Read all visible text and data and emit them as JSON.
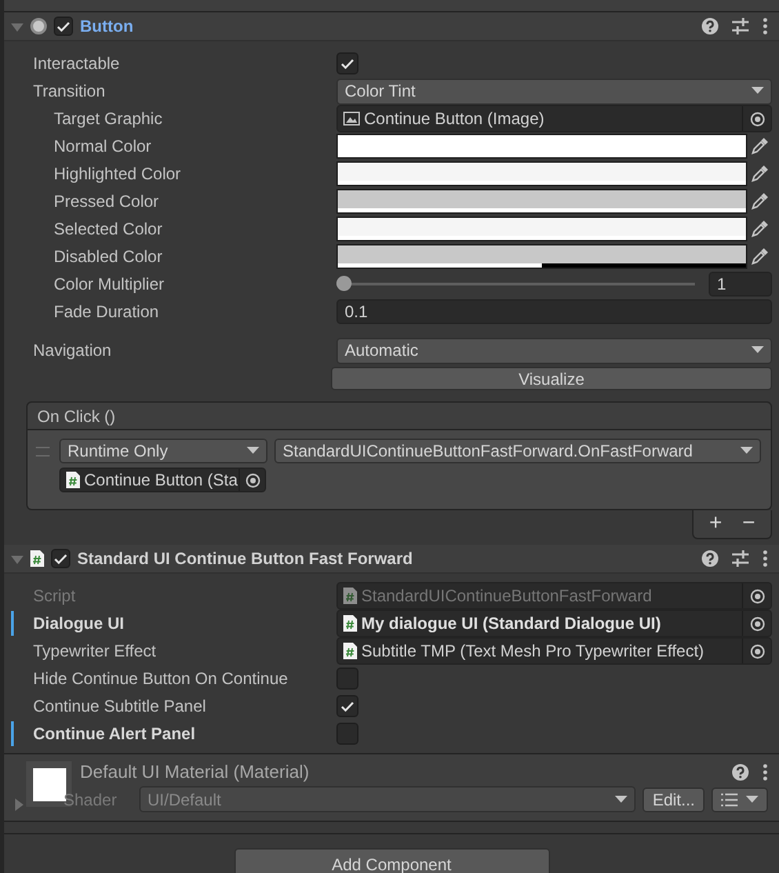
{
  "button_component": {
    "title": "Button",
    "highlighted": true,
    "enabled": true,
    "properties": [
      {
        "kind": "checkbox",
        "label": "Interactable",
        "checked": true
      },
      {
        "kind": "dropdown",
        "label": "Transition",
        "value": "Color Tint",
        "children": [
          {
            "kind": "image_object",
            "label": "Target Graphic",
            "value": "Continue Button (Image)"
          },
          {
            "kind": "color",
            "label": "Normal Color",
            "color": "#ffffff",
            "level": 1
          },
          {
            "kind": "color",
            "label": "Highlighted Color",
            "color": "#f5f5f5",
            "level": 1
          },
          {
            "kind": "color",
            "label": "Pressed Color",
            "color": "#c8c8c8",
            "level": 1
          },
          {
            "kind": "color",
            "label": "Selected Color",
            "color": "#f5f5f5",
            "level": 1
          },
          {
            "kind": "color",
            "label": "Disabled Color",
            "color": "#c8c8c8",
            "level": 0.5
          },
          {
            "kind": "slider",
            "label": "Color Multiplier",
            "level": 0,
            "value": "1"
          },
          {
            "kind": "number",
            "label": "Fade Duration",
            "value": "0.1"
          }
        ]
      }
    ],
    "navigation": {
      "label": "Navigation",
      "value": "Automatic"
    },
    "visualize_button": "Visualize",
    "event": {
      "title": "On Click ()",
      "listeners": [
        {
          "mode": "Runtime Only",
          "function": "StandardUIContinueButtonFastForward.OnFastForward",
          "target": "Continue Button (Sta"
        }
      ],
      "add": "+",
      "remove": "−"
    }
  },
  "script_component": {
    "title": "Standard UI Continue Button Fast Forward",
    "highlighted": false,
    "enabled": true,
    "properties": [
      {
        "kind": "object",
        "label": "Script",
        "value": "StandardUIContinueButtonFastForward",
        "disabled": true,
        "modified": false
      },
      {
        "kind": "object",
        "label": "Dialogue UI",
        "value": "My dialogue UI (Standard Dialogue UI)",
        "disabled": false,
        "modified": true
      },
      {
        "kind": "object",
        "label": "Typewriter Effect",
        "value": "Subtitle TMP (Text Mesh Pro Typewriter Effect)",
        "disabled": false,
        "modified": false
      },
      {
        "kind": "checkbox",
        "label": "Hide Continue Button On Continue",
        "checked": false,
        "modified": false
      },
      {
        "kind": "checkbox",
        "label": "Continue Subtitle Panel",
        "checked": true,
        "modified": false
      },
      {
        "kind": "checkbox",
        "label": "Continue Alert Panel",
        "checked": false,
        "modified": true
      }
    ]
  },
  "material": {
    "title": "Default UI Material (Material)",
    "shader_label": "Shader",
    "shader": "UI/Default",
    "edit_button": "Edit..."
  },
  "add_component_button": "Add Component"
}
